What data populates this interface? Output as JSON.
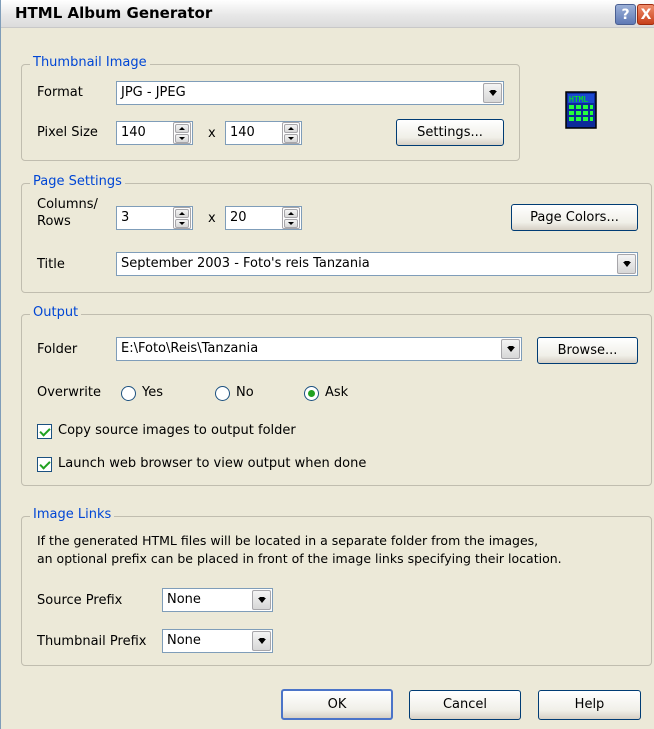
{
  "window": {
    "title": "HTML Album Generator",
    "help_label": "?",
    "close_label": "X"
  },
  "thumbnail": {
    "legend": "Thumbnail Image",
    "format_label": "Format",
    "format_value": "JPG - JPEG",
    "pixel_size_label": "Pixel Size",
    "width": "140",
    "height": "140",
    "times": "x",
    "settings_button": "Settings..."
  },
  "page_settings": {
    "legend": "Page Settings",
    "columns_rows_label_1": "Columns/",
    "columns_rows_label_2": "Rows",
    "columns": "3",
    "rows": "20",
    "times": "x",
    "page_colors_button": "Page Colors...",
    "title_label": "Title",
    "title_value": "September 2003 - Foto's reis Tanzania"
  },
  "output": {
    "legend": "Output",
    "folder_label": "Folder",
    "folder_value": "E:\\Foto\\Reis\\Tanzania",
    "browse_button": "Browse...",
    "overwrite_label": "Overwrite",
    "options": [
      "Yes",
      "No",
      "Ask"
    ],
    "selected": "Ask",
    "copy_source_label": "Copy source images to output folder",
    "copy_source_checked": true,
    "launch_browser_label": "Launch web browser to view output when done",
    "launch_browser_checked": true
  },
  "image_links": {
    "legend": "Image Links",
    "description_line1": "If the generated HTML files will be located in a separate folder from the images,",
    "description_line2": "an optional prefix can be placed in front of the image links specifying their location.",
    "source_prefix_label": "Source Prefix",
    "source_prefix_value": "None",
    "thumbnail_prefix_label": "Thumbnail Prefix",
    "thumbnail_prefix_value": "None"
  },
  "buttons": {
    "ok": "OK",
    "cancel": "Cancel",
    "help": "Help"
  },
  "colors": {
    "legend_text": "#0046d5",
    "dialog_bg": "#ece9d8",
    "check_mark": "#21a121"
  },
  "icons": [
    "html-file-icon",
    "combo-arrow-icon",
    "spinner-icon",
    "help-icon",
    "close-icon"
  ]
}
